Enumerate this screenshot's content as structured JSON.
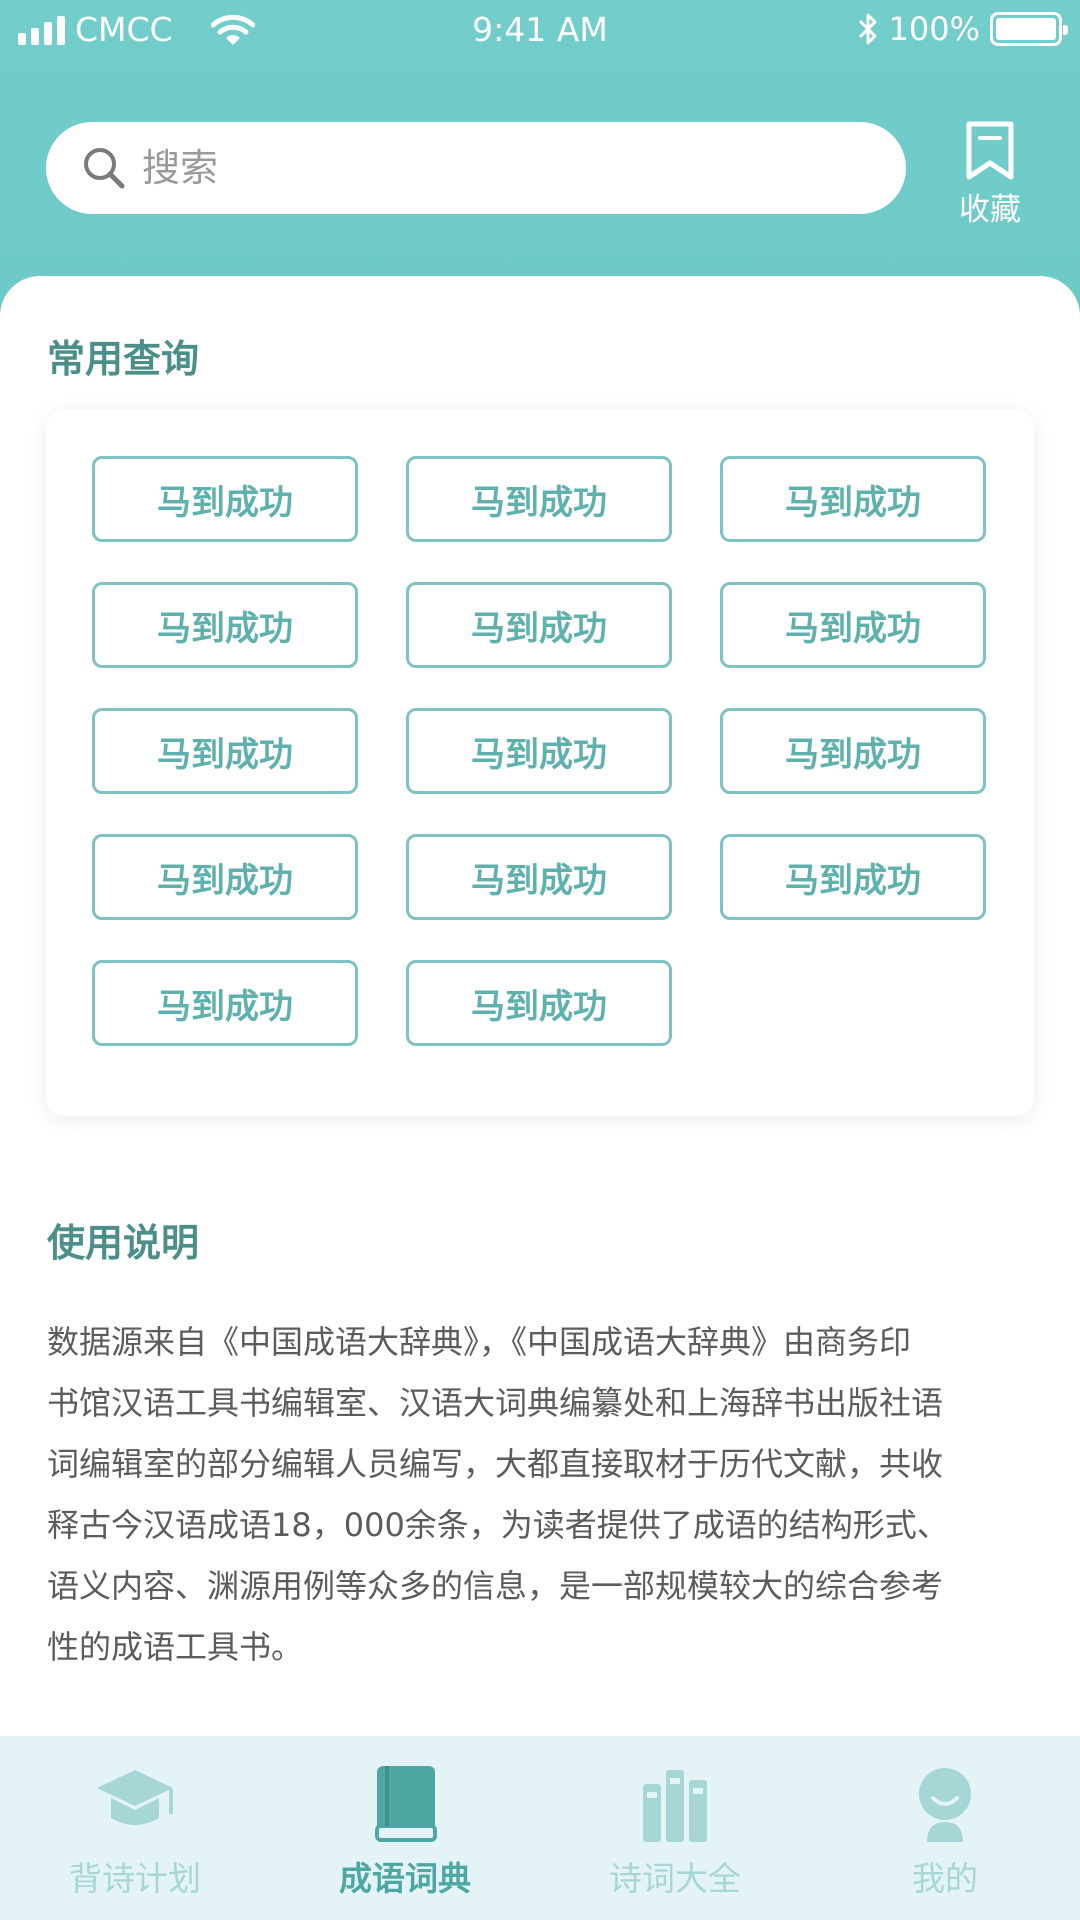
{
  "status_bar": {
    "carrier": "CMCC",
    "time": "9:41 AM",
    "battery": "100%"
  },
  "search": {
    "placeholder": "搜索"
  },
  "favorites": {
    "label": "收藏"
  },
  "common_queries": {
    "title": "常用查询",
    "items": [
      "马到成功",
      "马到成功",
      "马到成功",
      "马到成功",
      "马到成功",
      "马到成功",
      "马到成功",
      "马到成功",
      "马到成功",
      "马到成功",
      "马到成功",
      "马到成功",
      "马到成功",
      "马到成功"
    ]
  },
  "instructions": {
    "title": "使用说明",
    "lines": [
      "数据源来自《中国成语大辞典》，《中国成语大辞典》由商务印",
      "书馆汉语工具书编辑室、汉语大词典编纂处和上海辞书出版社语",
      "词编辑室的部分编辑人员编写，大都直接取材于历代文献，共收",
      "释古今汉语成语18，000余条，为读者提供了成语的结构形式、",
      "语义内容、渊源用例等众多的信息，是一部规模较大的综合参考",
      "性的成语工具书。"
    ]
  },
  "tabs": [
    {
      "label": "背诗计划",
      "icon": "graduation-cap-icon",
      "active": false
    },
    {
      "label": "成语词典",
      "icon": "book-icon",
      "active": true
    },
    {
      "label": "诗词大全",
      "icon": "books-icon",
      "active": false
    },
    {
      "label": "我的",
      "icon": "user-icon",
      "active": false
    }
  ],
  "colors": {
    "header": "#6ccac8",
    "accent": "#4fa7a4",
    "chip_border": "#7ec3c1",
    "tab_inactive": "#a6d6d5",
    "tabbar_bg": "#e4f3f6"
  }
}
